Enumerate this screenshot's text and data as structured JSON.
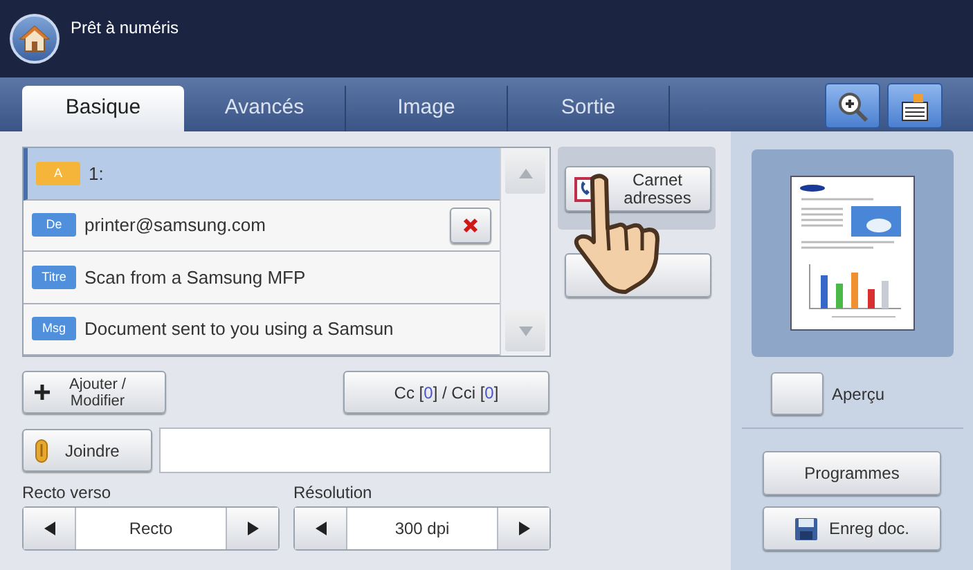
{
  "header": {
    "title": "Prêt à numéris"
  },
  "tabs": [
    {
      "label": "Basique",
      "selected": true
    },
    {
      "label": "Avancés",
      "selected": false
    },
    {
      "label": "Image",
      "selected": false
    },
    {
      "label": "Sortie",
      "selected": false
    }
  ],
  "recipients": [
    {
      "tag": "A",
      "text": "1:",
      "color": "#f4b53a",
      "selected": true,
      "deletable": false
    },
    {
      "tag": "De",
      "text": "printer@samsung.com",
      "color": "#4f8fdc",
      "selected": false,
      "deletable": true
    },
    {
      "tag": "Titre",
      "text": "Scan from a Samsung MFP",
      "color": "#4f8fdc",
      "selected": false,
      "deletable": false
    },
    {
      "tag": "Msg",
      "text": "Document sent to you using a Samsun",
      "color": "#4f8fdc",
      "selected": false,
      "deletable": false
    }
  ],
  "address_book_button": {
    "line_1": "Carnet",
    "line_2": "adresses"
  },
  "add_button": {
    "line_1": "Ajouter /",
    "line_2": "Modifier"
  },
  "cc_button": {
    "segments": [
      {
        "text": "Cc [",
        "kind": "plain"
      },
      {
        "text": "0",
        "kind": "count"
      },
      {
        "text": "] / Cci [",
        "kind": "plain"
      },
      {
        "text": "0",
        "kind": "count"
      },
      {
        "text": "]",
        "kind": "plain"
      }
    ]
  },
  "attach_button": {
    "label": "Joindre"
  },
  "spinners": [
    {
      "label": "Recto verso",
      "value": "Recto"
    },
    {
      "label": "Résolution",
      "value": "300 dpi"
    }
  ],
  "preview": {
    "label": "Aperçu",
    "checked": false
  },
  "buttons": [
    {
      "label": "Programmes",
      "kind": "plain"
    },
    {
      "label": "Enreg doc.",
      "kind": "save"
    }
  ]
}
